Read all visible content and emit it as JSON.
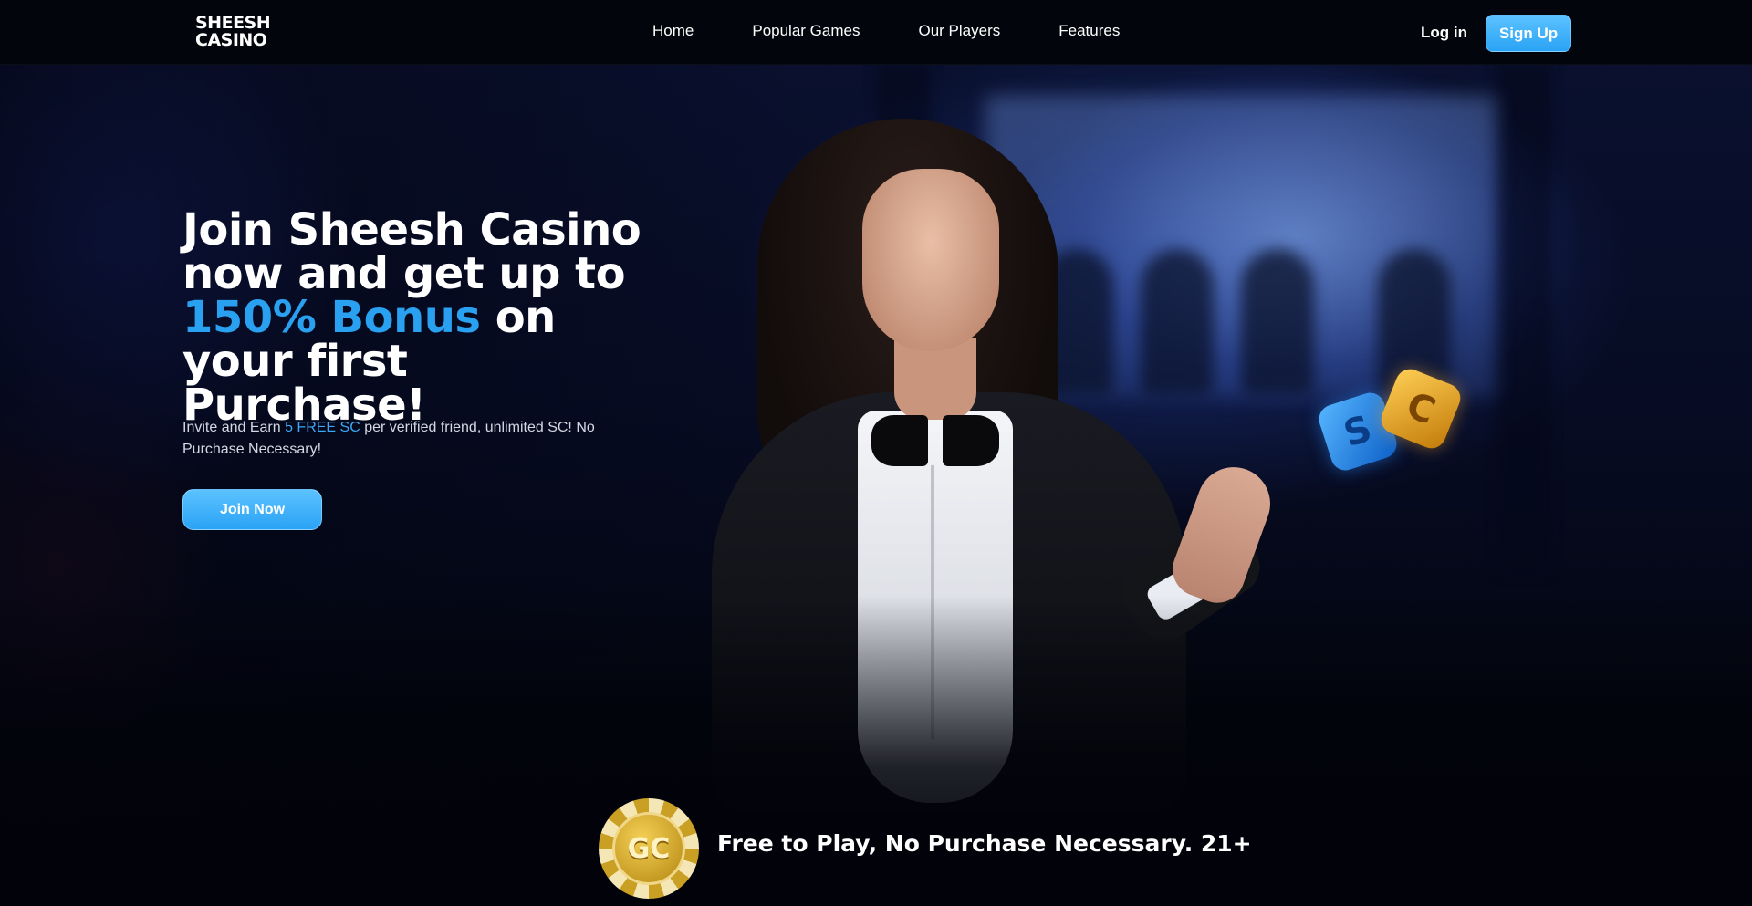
{
  "nav": {
    "logo_line1": "SHEESH",
    "logo_line2": "CASINO",
    "links": [
      "Home",
      "Popular Games",
      "Our Players",
      "Features"
    ],
    "login_label": "Log in",
    "signup_label": "Sign Up"
  },
  "hero": {
    "headline_part1": "Join Sheesh Casino now and get up to ",
    "headline_accent": "150% Bonus",
    "headline_part2": " on your first Purchase!",
    "sub_part1": "Invite and Earn ",
    "sub_accent": "5 FREE SC",
    "sub_part2": " per verified friend, unlimited SC! No Purchase Necessary!",
    "cta_label": "Join Now"
  },
  "dice": {
    "blue_glyph": "S",
    "gold_glyph": "C"
  },
  "footer": {
    "chip_label": "GC",
    "disclaimer": "Free to Play, No Purchase Necessary. 21+"
  },
  "colors": {
    "accent": "#2aa0f0",
    "button": "#3fb3fb",
    "background": "#03050e"
  }
}
